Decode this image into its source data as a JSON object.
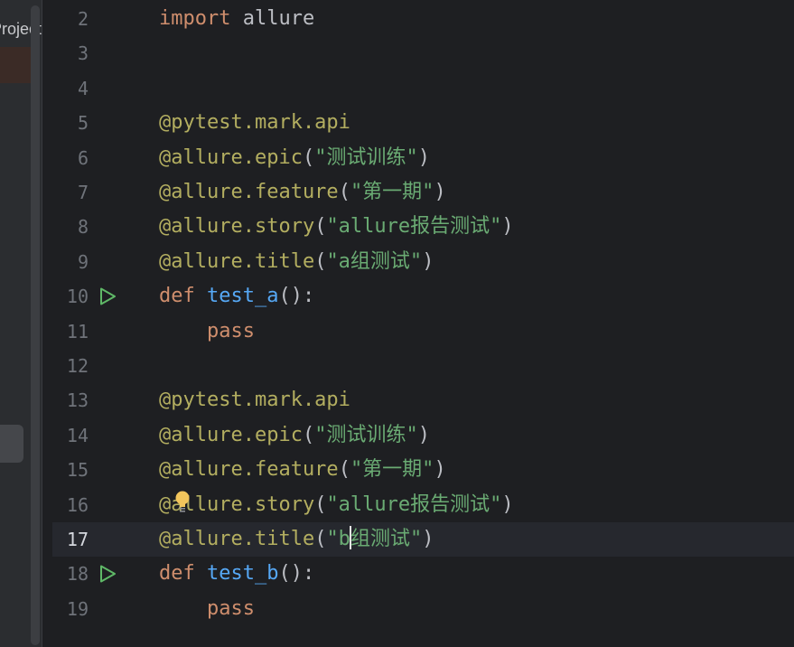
{
  "project_panel": {
    "title": "Project"
  },
  "editor": {
    "current_line": 17,
    "lines": [
      {
        "num": "2",
        "kw": "import",
        "mod": " allure"
      },
      {
        "num": "3"
      },
      {
        "num": "4"
      },
      {
        "num": "5",
        "deco": "@pytest.mark.api"
      },
      {
        "num": "6",
        "deco": "@allure.epic",
        "open": "(",
        "str": "\"测试训练\"",
        "close": ")"
      },
      {
        "num": "7",
        "deco": "@allure.feature",
        "open": "(",
        "str": "\"第一期\"",
        "close": ")"
      },
      {
        "num": "8",
        "deco": "@allure.story",
        "open": "(",
        "str": "\"allure报告测试\"",
        "close": ")"
      },
      {
        "num": "9",
        "deco": "@allure.title",
        "open": "(",
        "str": "\"a组测试\"",
        "close": ")"
      },
      {
        "num": "10",
        "kw": "def",
        "fn": "test_a",
        "rest": "():"
      },
      {
        "num": "11",
        "kw": "    pass"
      },
      {
        "num": "12"
      },
      {
        "num": "13",
        "deco": "@pytest.mark.api"
      },
      {
        "num": "14",
        "deco": "@allure.epic",
        "open": "(",
        "str": "\"测试训练\"",
        "close": ")"
      },
      {
        "num": "15",
        "deco": "@allure.feature",
        "open": "(",
        "str": "\"第一期\"",
        "close": ")"
      },
      {
        "num": "16",
        "deco": "@allure.story",
        "open": "(",
        "str": "\"allure报告测试\"",
        "close": ")"
      },
      {
        "num": "17",
        "deco": "@allure.title",
        "open": "(",
        "str_a": "\"b",
        "str_b": "组测试\"",
        "close": ")"
      },
      {
        "num": "18",
        "kw": "def",
        "fn": "test_b",
        "rest": "():"
      },
      {
        "num": "19",
        "kw": "    pass"
      }
    ]
  },
  "colors": {
    "keyword": "#cf8e6d",
    "decorator": "#b3ae60",
    "string": "#6aab73",
    "function": "#56a8f5",
    "run_icon": "#5fb867",
    "bulb": "#f2c55c"
  },
  "icons": {
    "run": "run-test-icon",
    "bulb": "intention-bulb-icon"
  }
}
